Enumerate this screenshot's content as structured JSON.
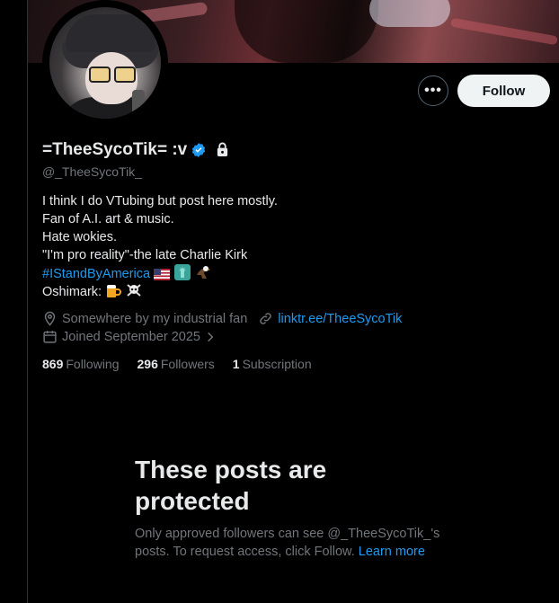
{
  "profile": {
    "name": "=TheeSycoTik= :v",
    "handle": "@_TheeSycoTik_",
    "verified": true,
    "protected": true,
    "bio": {
      "line1": "I think I do VTubing but post here mostly.",
      "line2": "Fan of A.I. art & music.",
      "line3": "Hate wokies.",
      "line4": "\"I'm pro reality\"-the late Charlie Kirk",
      "hashtag": "#IStandByAmerica",
      "oshimark_label": "Oshimark:",
      "hashtag_emojis": [
        "us-flag-icon",
        "statue-of-liberty-icon",
        "eagle-icon"
      ],
      "oshimark_emojis": [
        "beer-icon",
        "skull-crossbones-icon"
      ]
    },
    "location": "Somewhere by my industrial fan",
    "website": "linktr.ee/TheeSycoTik",
    "joined": "Joined September 2025",
    "stats": {
      "following_count": "869",
      "following_label": "Following",
      "followers_count": "296",
      "followers_label": "Followers",
      "subscriptions_count": "1",
      "subscriptions_label": "Subscription"
    }
  },
  "actions": {
    "more_label": "•••",
    "follow_label": "Follow"
  },
  "protected_notice": {
    "title": "These posts are protected",
    "description": "Only approved followers can see @_TheeSycoTik_'s posts. To request access, click Follow. ",
    "learn_more": "Learn more"
  },
  "colors": {
    "background": "#000000",
    "accent": "#1d9bf0",
    "muted": "#71767b",
    "text": "#e7e9ea",
    "follow_button_bg": "#eff3f4"
  }
}
